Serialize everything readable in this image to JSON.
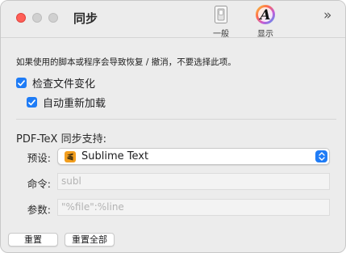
{
  "window": {
    "title": "同步"
  },
  "toolbar": {
    "items": [
      {
        "label": "一般",
        "icon": "light-switch-icon"
      },
      {
        "label": "显示",
        "icon": "font-color-icon",
        "glyph": "A"
      }
    ],
    "overflow": "»"
  },
  "content": {
    "warning": "如果使用的脚本或程序会导致恢复 / 撤消，不要选择此项。",
    "check_file_changes": {
      "label": "检查文件变化",
      "checked": true
    },
    "auto_reload": {
      "label": "自动重新加载",
      "checked": true
    },
    "section_title": "PDF-TeX 同步支持:",
    "preset": {
      "label": "预设:",
      "value": "Sublime Text",
      "icon": "sublime-text-icon"
    },
    "command": {
      "label": "命令:",
      "placeholder": "subl"
    },
    "arguments": {
      "label": "参数:",
      "placeholder": "\"%file\":%line"
    }
  },
  "buttons": {
    "reset": "重置",
    "reset_all": "重置全部"
  },
  "colors": {
    "accent": "#1f7cf6",
    "close": "#ff5f57",
    "sublime": "#f29e1e"
  }
}
